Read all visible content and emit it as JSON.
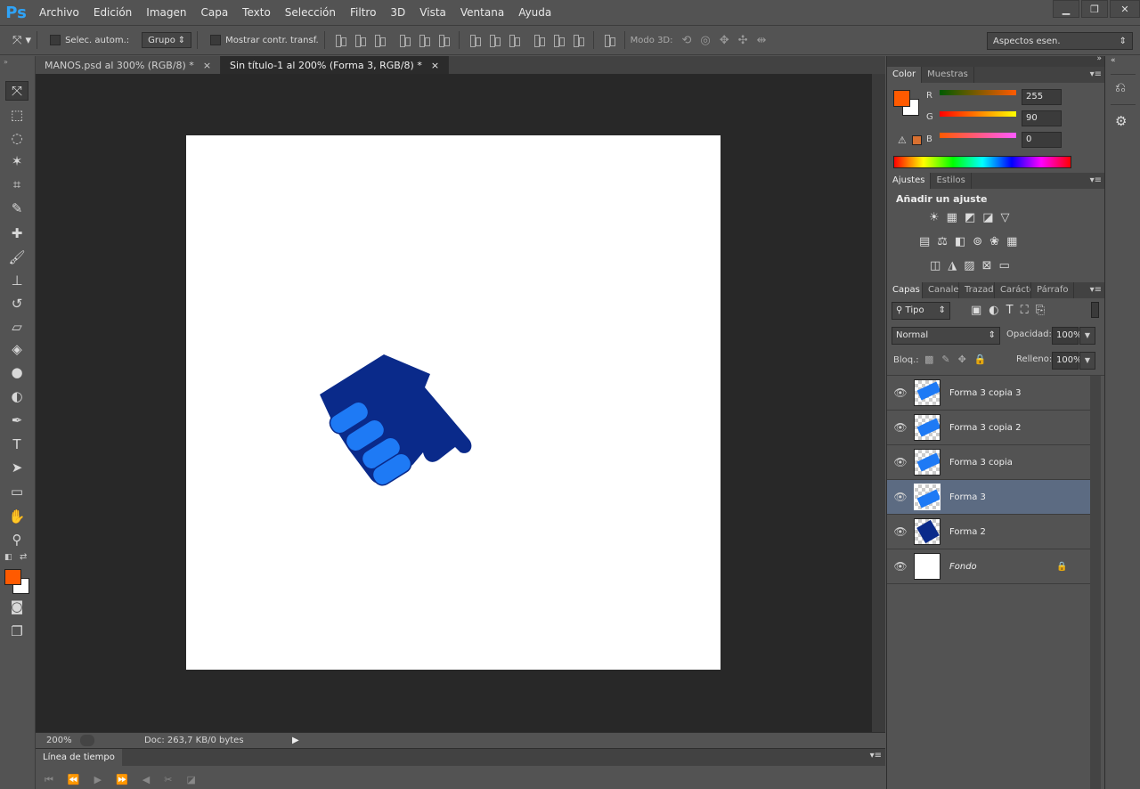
{
  "app": {
    "logo": "Ps"
  },
  "menu": [
    "Archivo",
    "Edición",
    "Imagen",
    "Capa",
    "Texto",
    "Selección",
    "Filtro",
    "3D",
    "Vista",
    "Ventana",
    "Ayuda"
  ],
  "window_controls": {
    "minimize": "▁",
    "restore": "❐",
    "close": "✕"
  },
  "options": {
    "auto_select_label": "Selec. autom.:",
    "group_select": "Grupo",
    "show_transform_label": "Mostrar contr. transf.",
    "mode3d_label": "Modo 3D:",
    "workspace": "Aspectos esen."
  },
  "tabs": [
    {
      "label": "MANOS.psd al 300% (RGB/8) *",
      "close": "×"
    },
    {
      "label": "Sin título-1 al 200% (Forma 3, RGB/8) *",
      "close": "×"
    }
  ],
  "status": {
    "zoom": "200%",
    "doc_info": "Doc: 263,7 KB/0 bytes"
  },
  "timeline": {
    "title": "Línea de tiempo"
  },
  "color_panel": {
    "tabs": [
      "Color",
      "Muestras"
    ],
    "r_label": "R",
    "g_label": "G",
    "b_label": "B",
    "r": "255",
    "g": "90",
    "b": "0",
    "foreground": "#ff5a00",
    "background": "#ffffff"
  },
  "adjustments_panel": {
    "tabs": [
      "Ajustes",
      "Estilos"
    ],
    "title": "Añadir un ajuste"
  },
  "layers_panel": {
    "tabs": [
      "Capas",
      "Canales",
      "Trazados",
      "Carácter",
      "Párrafo"
    ],
    "filter": "Tipo",
    "blend_mode": "Normal",
    "opacity_label": "Opacidad:",
    "opacity": "100%",
    "lock_label": "Bloq.:",
    "fill_label": "Relleno:",
    "fill": "100%",
    "layers": [
      {
        "name": "Forma 3 copia 3"
      },
      {
        "name": "Forma 3 copia 2"
      },
      {
        "name": "Forma 3 copia"
      },
      {
        "name": "Forma 3"
      },
      {
        "name": "Forma 2"
      },
      {
        "name": "Fondo"
      }
    ]
  },
  "colors": {
    "hand_dark": "#0a2a8a",
    "fingers_light": "#1e7af5",
    "accent": "#ff5a00"
  }
}
